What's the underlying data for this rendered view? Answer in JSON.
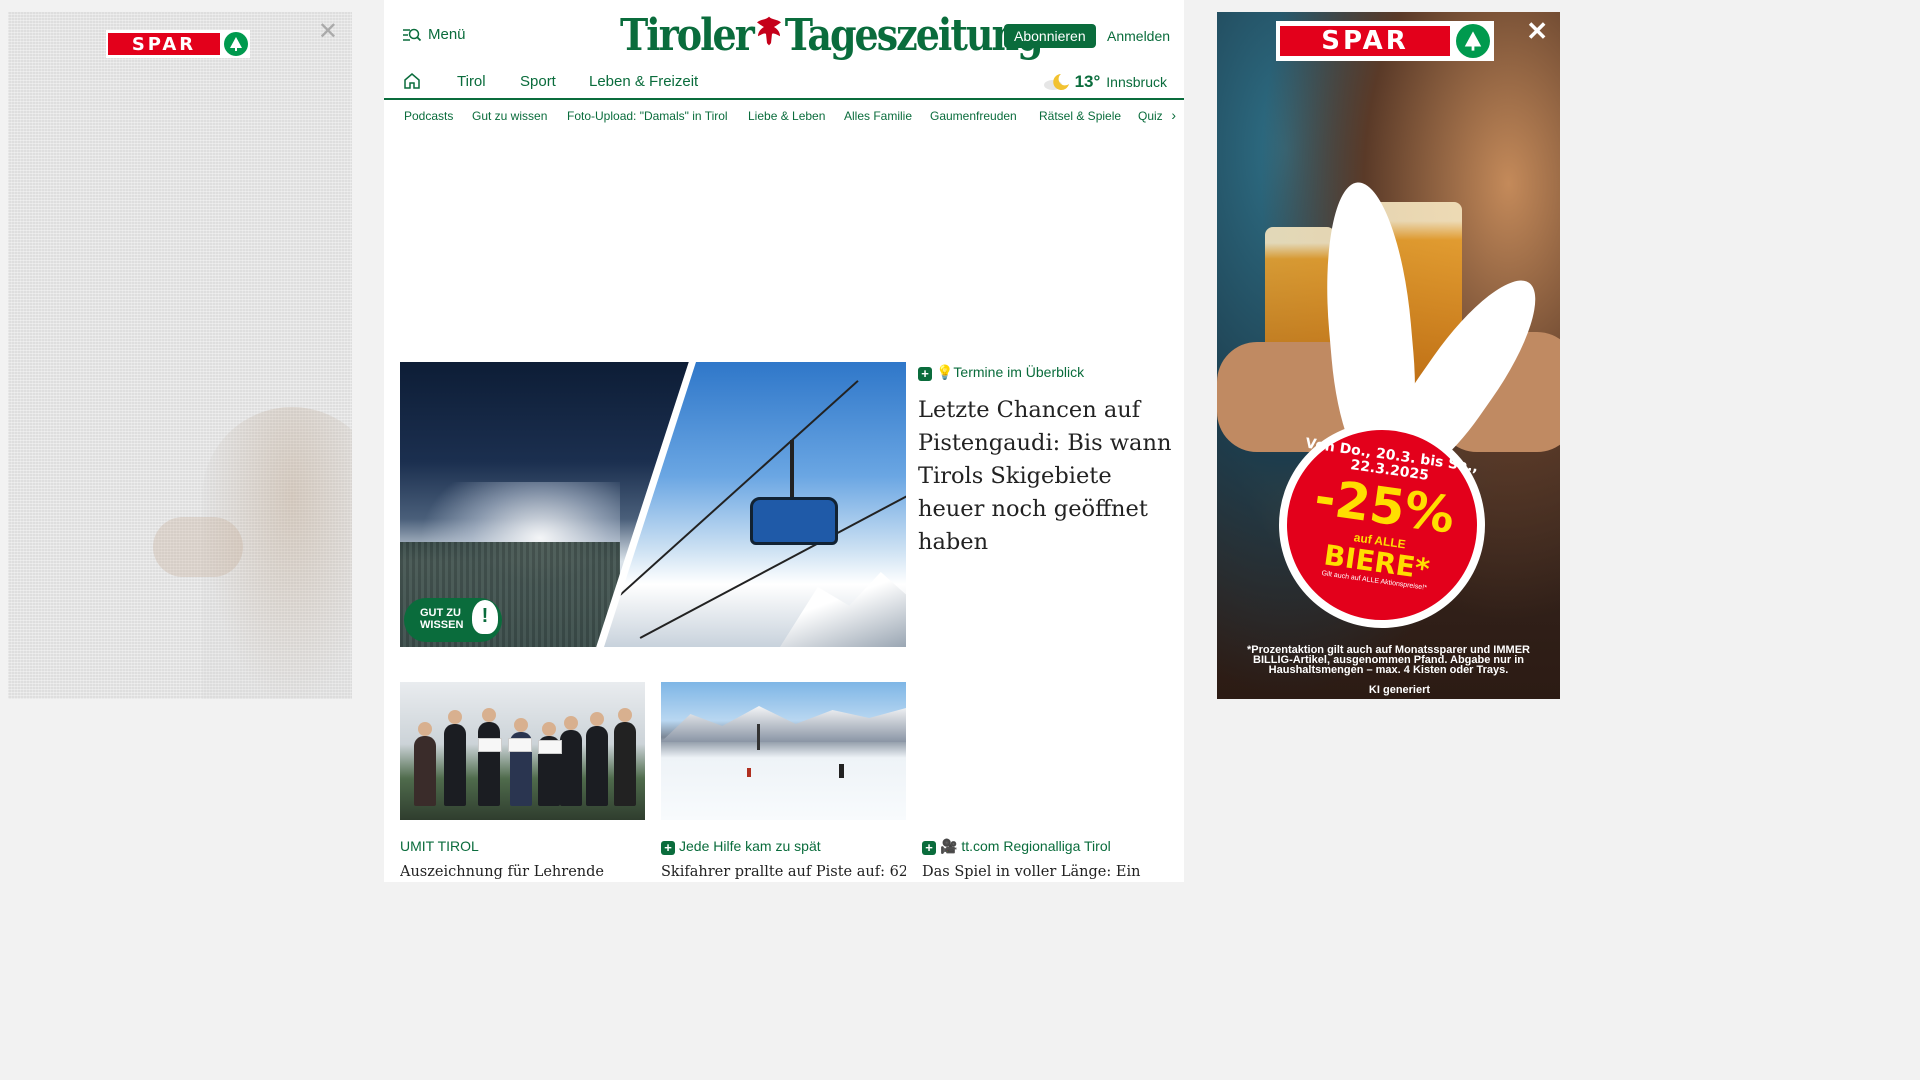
{
  "ads": {
    "left": {
      "brand": "SPAR",
      "close": "✕"
    },
    "right": {
      "brand": "SPAR",
      "close": "✕",
      "promo_date": "Von Do., 20.3. bis Sa., 22.3.2025",
      "promo_discount": "-25%",
      "promo_on": "auf ALLE",
      "promo_product": "BIERE*",
      "promo_note": "Gilt auch auf ALLE Aktionspreise!*",
      "fine_print": "*Prozentaktion gilt auch auf Monatssparer und IMMER BILLIG-Artikel, ausgenommen Pfand. Abgabe nur in Haushaltsmengen – max. 4 Kisten oder Trays.",
      "ai_label": "KI generiert"
    }
  },
  "header": {
    "menu_label": "Menü",
    "logo_left": "Tiroler",
    "logo_right": "Tageszeitung",
    "subscribe": "Abonnieren",
    "login": "Anmelden"
  },
  "nav": {
    "items": [
      "Tirol",
      "Sport",
      "Leben & Freizeit"
    ],
    "weather": {
      "temp": "13°",
      "city": "Innsbruck",
      "icon": "moon-cloud-icon"
    }
  },
  "subnav": {
    "items": [
      "Podcasts",
      "Gut zu wissen",
      "Foto-Upload: \"Damals\" in Tirol",
      "Liebe & Leben",
      "Alles Familie",
      "Gaumenfreuden",
      "Rätsel & Spiele",
      "Quiz"
    ],
    "next_icon": "›"
  },
  "hero": {
    "badge": "GUT ZU\nWISSEN",
    "badge_line1": "GUT ZU",
    "badge_line2": "WISSEN",
    "kicker": "💡Termine im Überblick",
    "title": "Letzte Chancen auf Pistengaudi: Bis wann Tirols Skigebiete heuer noch geöffnet haben"
  },
  "cards": [
    {
      "kicker": "UMIT TIROL",
      "premium": false,
      "title": "Auszeichnung für Lehrende"
    },
    {
      "kicker": "Jede Hilfe kam zu spät",
      "premium": true,
      "title": "Skifahrer prallte auf Piste auf: 62-"
    },
    {
      "kicker": "🎥 tt.com Regionalliga Tirol",
      "premium": true,
      "title": "Das Spiel in voller Länge: Ein"
    }
  ],
  "colors": {
    "brand_green": "#0a6c3c",
    "spar_red": "#e3001b",
    "spar_green": "#009a4e"
  }
}
